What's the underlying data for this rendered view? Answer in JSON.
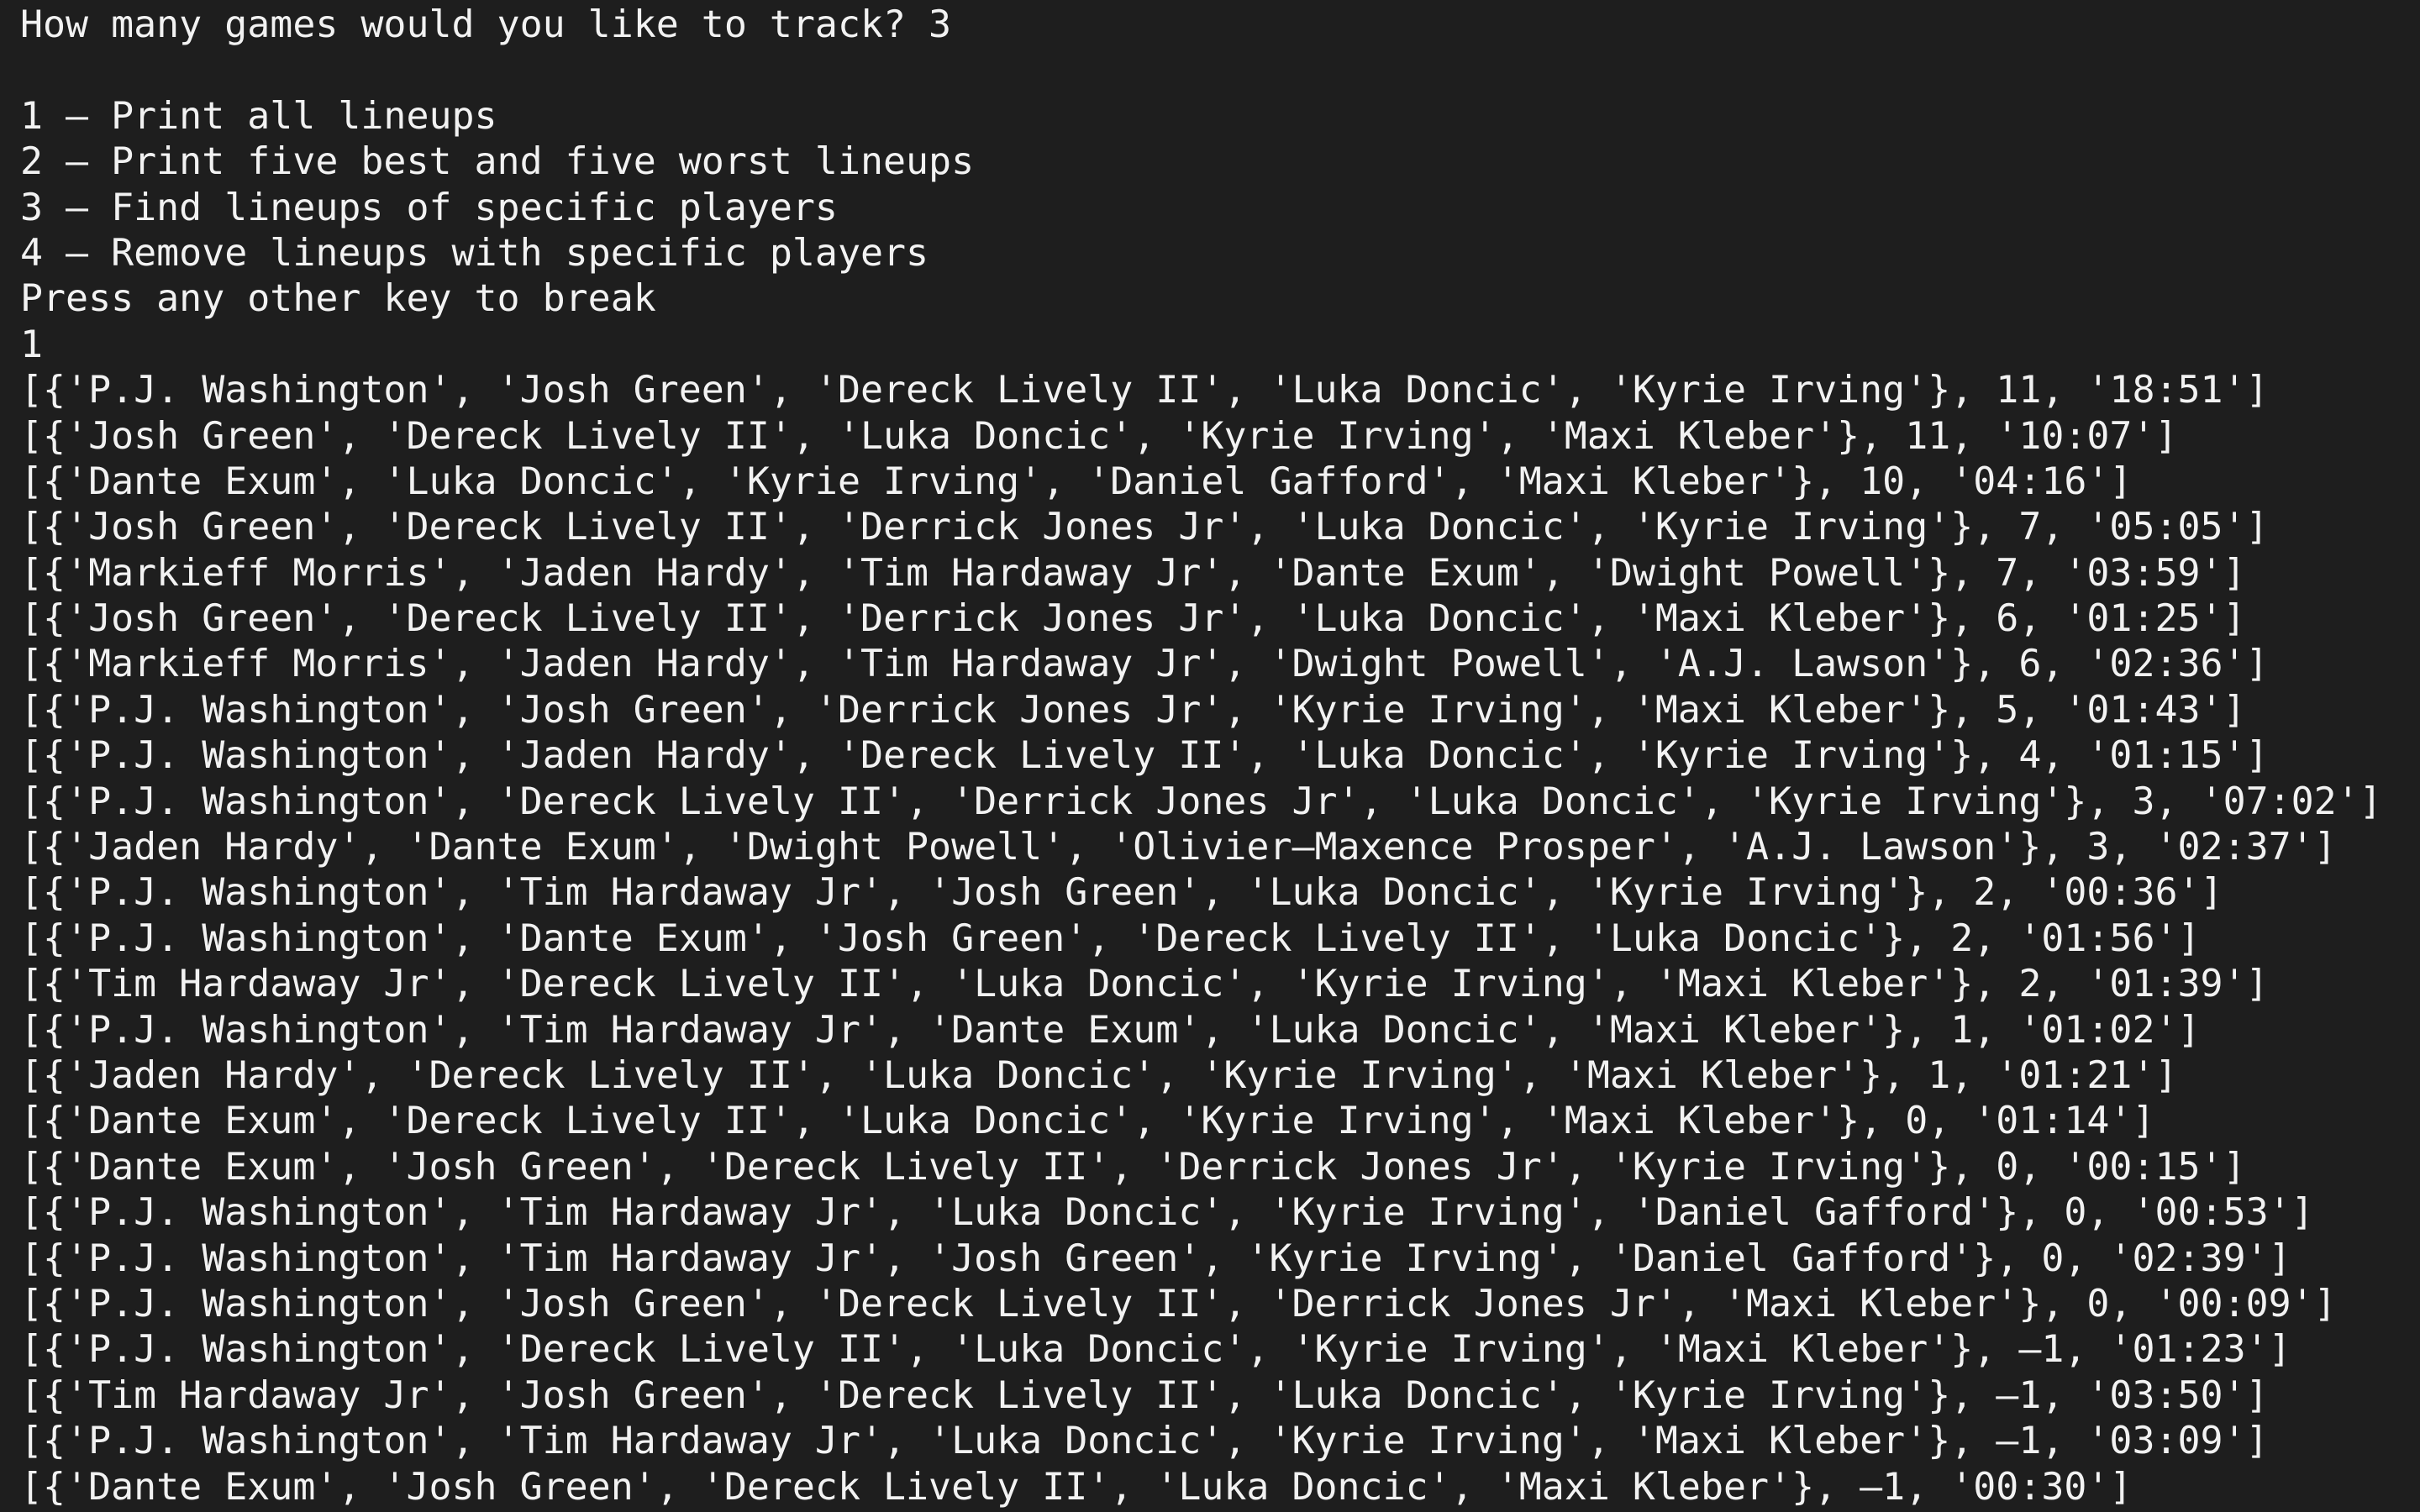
{
  "terminal": {
    "prompt_line": "How many games would you like to track? 3",
    "menu": [
      "1 – Print all lineups",
      "2 – Print five best and five worst lineups",
      "3 – Find lineups of specific players",
      "4 – Remove lineups with specific players",
      "Press any other key to break"
    ],
    "user_input": "1",
    "output_lines": [
      "[{'P.J. Washington', 'Josh Green', 'Dereck Lively II', 'Luka Doncic', 'Kyrie Irving'}, 11, '18:51']",
      "[{'Josh Green', 'Dereck Lively II', 'Luka Doncic', 'Kyrie Irving', 'Maxi Kleber'}, 11, '10:07']",
      "[{'Dante Exum', 'Luka Doncic', 'Kyrie Irving', 'Daniel Gafford', 'Maxi Kleber'}, 10, '04:16']",
      "[{'Josh Green', 'Dereck Lively II', 'Derrick Jones Jr', 'Luka Doncic', 'Kyrie Irving'}, 7, '05:05']",
      "[{'Markieff Morris', 'Jaden Hardy', 'Tim Hardaway Jr', 'Dante Exum', 'Dwight Powell'}, 7, '03:59']",
      "[{'Josh Green', 'Dereck Lively II', 'Derrick Jones Jr', 'Luka Doncic', 'Maxi Kleber'}, 6, '01:25']",
      "[{'Markieff Morris', 'Jaden Hardy', 'Tim Hardaway Jr', 'Dwight Powell', 'A.J. Lawson'}, 6, '02:36']",
      "[{'P.J. Washington', 'Josh Green', 'Derrick Jones Jr', 'Kyrie Irving', 'Maxi Kleber'}, 5, '01:43']",
      "[{'P.J. Washington', 'Jaden Hardy', 'Dereck Lively II', 'Luka Doncic', 'Kyrie Irving'}, 4, '01:15']",
      "[{'P.J. Washington', 'Dereck Lively II', 'Derrick Jones Jr', 'Luka Doncic', 'Kyrie Irving'}, 3, '07:02']",
      "[{'Jaden Hardy', 'Dante Exum', 'Dwight Powell', 'Olivier–Maxence Prosper', 'A.J. Lawson'}, 3, '02:37']",
      "[{'P.J. Washington', 'Tim Hardaway Jr', 'Josh Green', 'Luka Doncic', 'Kyrie Irving'}, 2, '00:36']",
      "[{'P.J. Washington', 'Dante Exum', 'Josh Green', 'Dereck Lively II', 'Luka Doncic'}, 2, '01:56']",
      "[{'Tim Hardaway Jr', 'Dereck Lively II', 'Luka Doncic', 'Kyrie Irving', 'Maxi Kleber'}, 2, '01:39']",
      "[{'P.J. Washington', 'Tim Hardaway Jr', 'Dante Exum', 'Luka Doncic', 'Maxi Kleber'}, 1, '01:02']",
      "[{'Jaden Hardy', 'Dereck Lively II', 'Luka Doncic', 'Kyrie Irving', 'Maxi Kleber'}, 1, '01:21']",
      "[{'Dante Exum', 'Dereck Lively II', 'Luka Doncic', 'Kyrie Irving', 'Maxi Kleber'}, 0, '01:14']",
      "[{'Dante Exum', 'Josh Green', 'Dereck Lively II', 'Derrick Jones Jr', 'Kyrie Irving'}, 0, '00:15']",
      "[{'P.J. Washington', 'Tim Hardaway Jr', 'Luka Doncic', 'Kyrie Irving', 'Daniel Gafford'}, 0, '00:53']",
      "[{'P.J. Washington', 'Tim Hardaway Jr', 'Josh Green', 'Kyrie Irving', 'Daniel Gafford'}, 0, '02:39']",
      "[{'P.J. Washington', 'Josh Green', 'Dereck Lively II', 'Derrick Jones Jr', 'Maxi Kleber'}, 0, '00:09']",
      "[{'P.J. Washington', 'Dereck Lively II', 'Luka Doncic', 'Kyrie Irving', 'Maxi Kleber'}, –1, '01:23']",
      "[{'Tim Hardaway Jr', 'Josh Green', 'Dereck Lively II', 'Luka Doncic', 'Kyrie Irving'}, –1, '03:50']",
      "[{'P.J. Washington', 'Tim Hardaway Jr', 'Luka Doncic', 'Kyrie Irving', 'Maxi Kleber'}, –1, '03:09']",
      "[{'Dante Exum', 'Josh Green', 'Dereck Lively II', 'Luka Doncic', 'Maxi Kleber'}, –1, '00:30']"
    ],
    "colors": {
      "background": "#1e1e1e",
      "text": "#f2f2f2"
    }
  }
}
